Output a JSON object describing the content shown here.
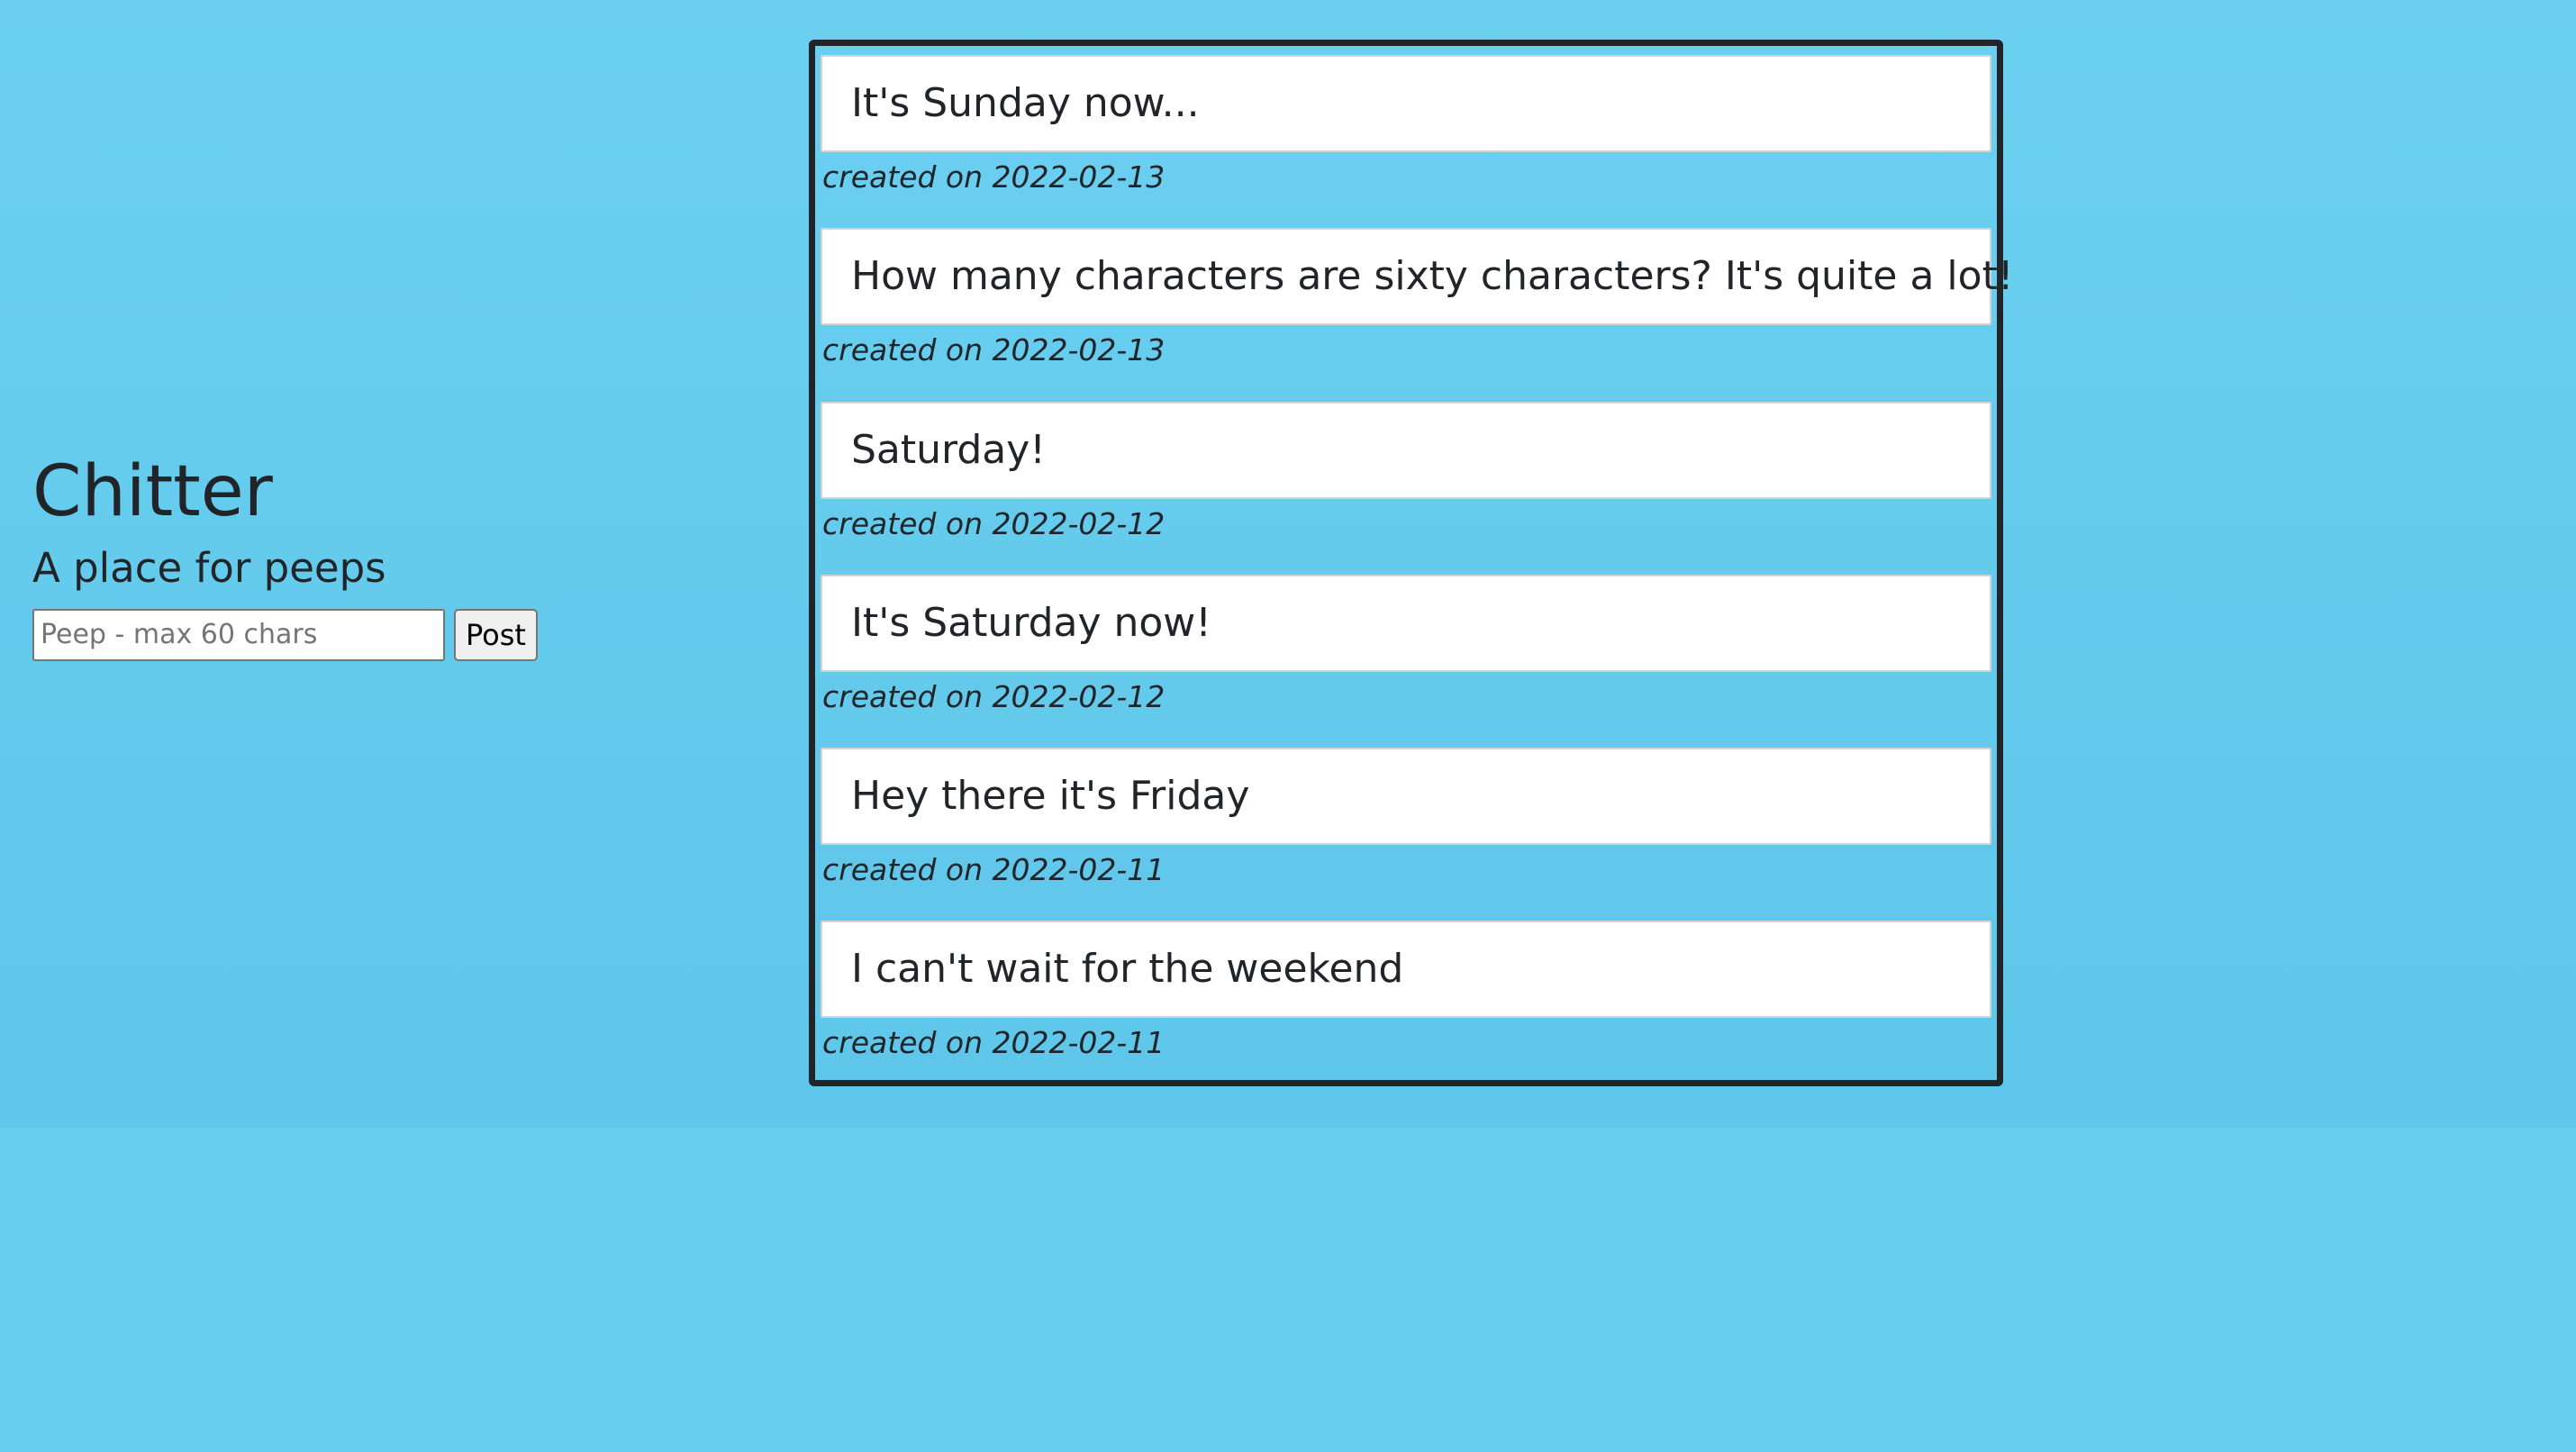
{
  "app": {
    "title": "Chitter",
    "subtitle": "A place for peeps"
  },
  "form": {
    "input_placeholder": "Peep - max 60 chars",
    "input_value": "",
    "post_label": "Post"
  },
  "colors": {
    "background": "#67cdee",
    "card": "#ffffff",
    "text": "#212529",
    "feed_border": "#212529"
  },
  "feed": {
    "peeps": [
      {
        "text": "It's Sunday now...",
        "created": "created on 2022-02-13"
      },
      {
        "text": "How many characters are sixty characters? It's quite a lot!",
        "created": "created on 2022-02-13"
      },
      {
        "text": "Saturday!",
        "created": "created on 2022-02-12"
      },
      {
        "text": "It's Saturday now!",
        "created": "created on 2022-02-12"
      },
      {
        "text": "Hey there it's Friday",
        "created": "created on 2022-02-11"
      },
      {
        "text": "I can't wait for the weekend",
        "created": "created on 2022-02-11"
      }
    ]
  }
}
